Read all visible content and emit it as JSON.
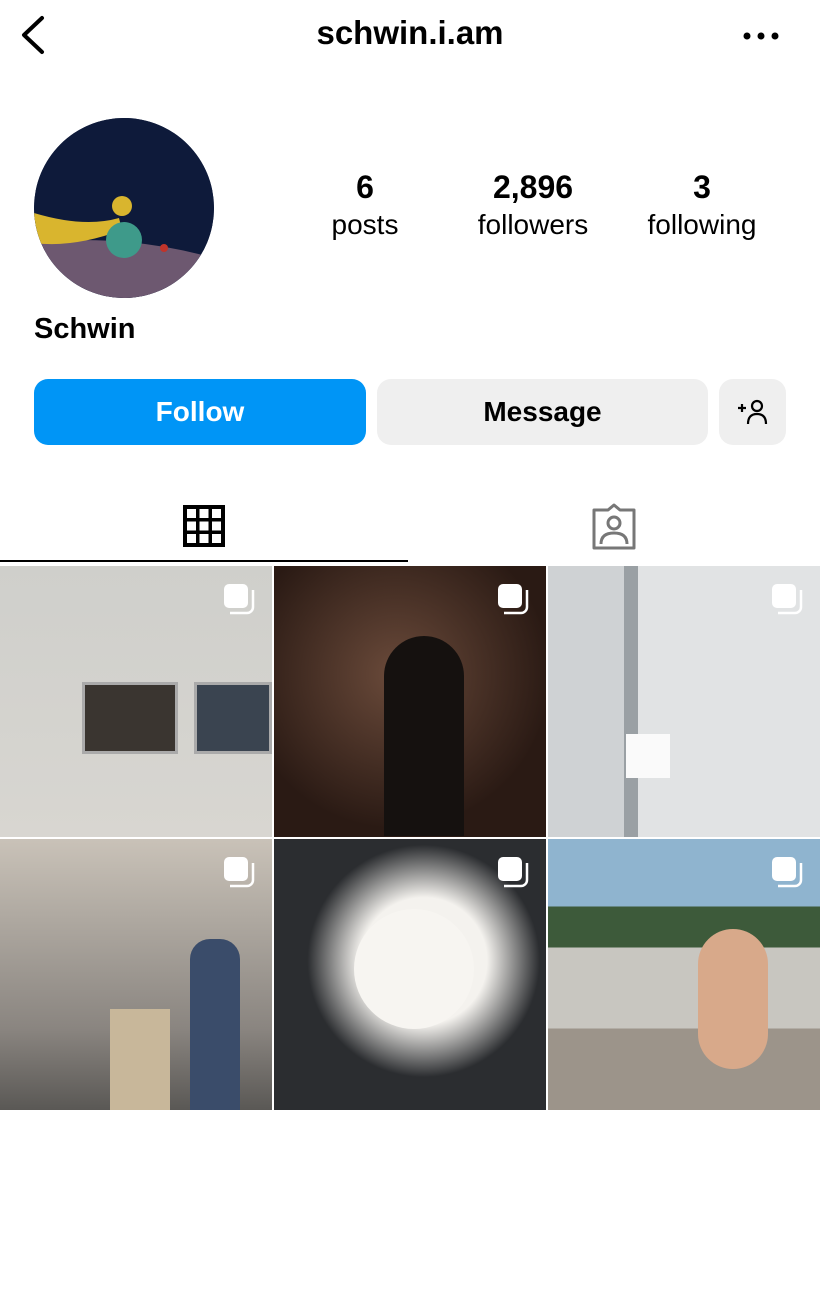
{
  "header": {
    "username": "schwin.i.am",
    "back_icon": "chevron-left-icon",
    "more_icon": "ellipsis-icon"
  },
  "profile": {
    "display_name": "Schwin",
    "stats": [
      {
        "value": "6",
        "label": "posts"
      },
      {
        "value": "2,896",
        "label": "followers"
      },
      {
        "value": "3",
        "label": "following"
      }
    ]
  },
  "actions": {
    "follow_label": "Follow",
    "message_label": "Message",
    "add_user_icon": "add-person-icon",
    "accent": "#0095f6"
  },
  "tabs": [
    {
      "icon": "grid-icon",
      "active": true
    },
    {
      "icon": "tagged-person-icon",
      "active": false
    }
  ],
  "grid": {
    "posts": [
      {
        "multi": true
      },
      {
        "multi": true
      },
      {
        "multi": true
      },
      {
        "multi": true
      },
      {
        "multi": true
      },
      {
        "multi": true
      }
    ]
  }
}
